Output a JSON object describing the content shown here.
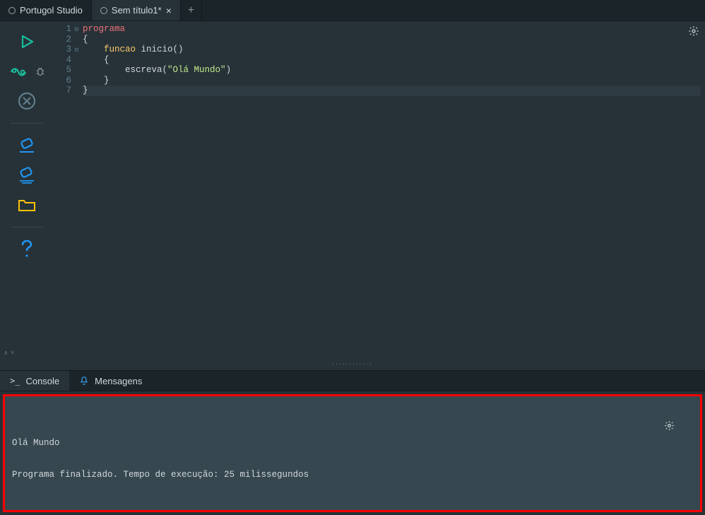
{
  "tabs": {
    "home": "Portugol Studio",
    "file": "Sem título1*",
    "close": "×",
    "new": "+"
  },
  "code": {
    "lines": [
      "1",
      "2",
      "3",
      "4",
      "5",
      "6",
      "7"
    ],
    "l1_kw": "programa",
    "l2_brace": "{",
    "l3_kw": "funcao",
    "l3_ident": " inicio",
    "l3_paren": "()",
    "l4_brace": "{",
    "l5_ident": "escreva",
    "l5_p1": "(",
    "l5_str": "\"Olá Mundo\"",
    "l5_p2": ")",
    "l6_brace": "}",
    "l7_brace": "}"
  },
  "splitter_dots": "............",
  "bottom": {
    "console": "Console",
    "mensagens": "Mensagens"
  },
  "console": {
    "line1": "Olá Mundo",
    "line2": "Programa finalizado. Tempo de execução: 25 milissegundos"
  },
  "icons": {
    "run": "run-icon",
    "debug": "debug-icon",
    "bug": "bug-icon",
    "stop": "stop-icon",
    "eraser": "eraser-icon",
    "eraser2": "eraser2-icon",
    "folder": "folder-icon",
    "help": "help-icon",
    "gear": "gear-icon",
    "bulb": "bulb-icon",
    "bell": "bell-icon",
    "prompt": "prompt-icon"
  }
}
